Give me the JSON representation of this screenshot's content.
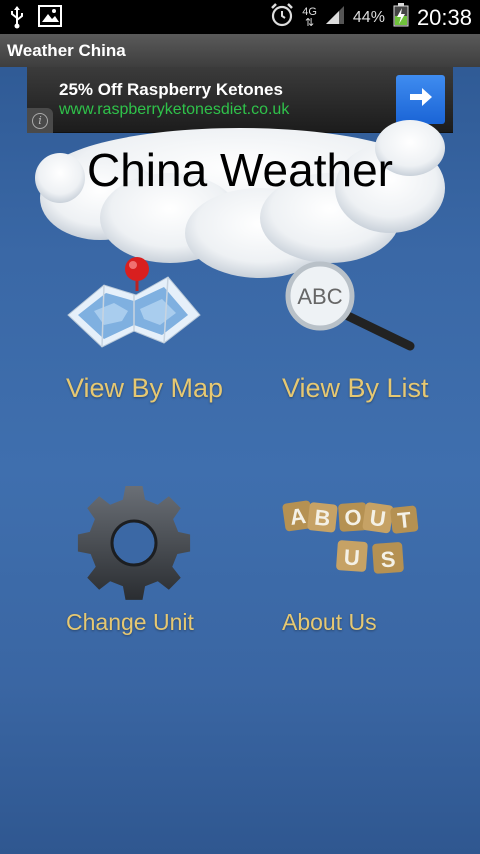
{
  "status_bar": {
    "network": "4G",
    "battery": "44%",
    "time": "20:38",
    "icons": [
      "usb-icon",
      "image-icon",
      "alarm-icon",
      "signal-icon",
      "battery-charging-icon"
    ]
  },
  "app_bar": {
    "title": "Weather China"
  },
  "ad": {
    "headline": "25% Off Raspberry Ketones",
    "url": "www.raspberryketonesdiet.co.uk",
    "info_icon": "info-icon",
    "action_icon": "arrow-right-icon",
    "accent_color": "#2a78e4"
  },
  "header": {
    "title": "China Weather"
  },
  "menu": {
    "view_by_map": "View By Map",
    "view_by_list": "View By List",
    "change_unit": "Change Unit",
    "about_us": "About Us"
  },
  "about_tiles": [
    "A",
    "B",
    "O",
    "U",
    "T",
    "U",
    "S"
  ],
  "map_search_text": "ABC",
  "colors": {
    "background": "#3a68a6",
    "label": "#e6c872",
    "title_bar": "#4a4a4a"
  }
}
